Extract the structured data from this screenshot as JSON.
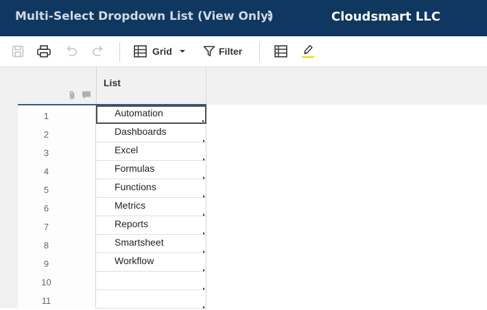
{
  "header": {
    "sheet_title": "Multi-Select Dropdown List (View Only)",
    "menu_glyph": "⋮",
    "company": "Cloudsmart LLC",
    "background_color": "#0f3760"
  },
  "toolbar": {
    "icons": [
      "save-icon",
      "print-icon",
      "undo-icon",
      "redo-icon",
      "grid-view-icon",
      "filter-icon",
      "row-layout-icon",
      "highlight-icon"
    ],
    "grid_label": "Grid",
    "filter_label": "Filter",
    "highlight_color": "#f1dd4a"
  },
  "sheet": {
    "column_header": "List",
    "rows": [
      {
        "number": "1",
        "value": "Automation"
      },
      {
        "number": "2",
        "value": "Dashboards"
      },
      {
        "number": "3",
        "value": "Excel"
      },
      {
        "number": "4",
        "value": "Formulas"
      },
      {
        "number": "5",
        "value": "Functions"
      },
      {
        "number": "6",
        "value": "Metrics"
      },
      {
        "number": "7",
        "value": "Reports"
      },
      {
        "number": "8",
        "value": "Smartsheet"
      },
      {
        "number": "9",
        "value": "Workflow"
      },
      {
        "number": "10",
        "value": ""
      },
      {
        "number": "11",
        "value": ""
      }
    ]
  }
}
